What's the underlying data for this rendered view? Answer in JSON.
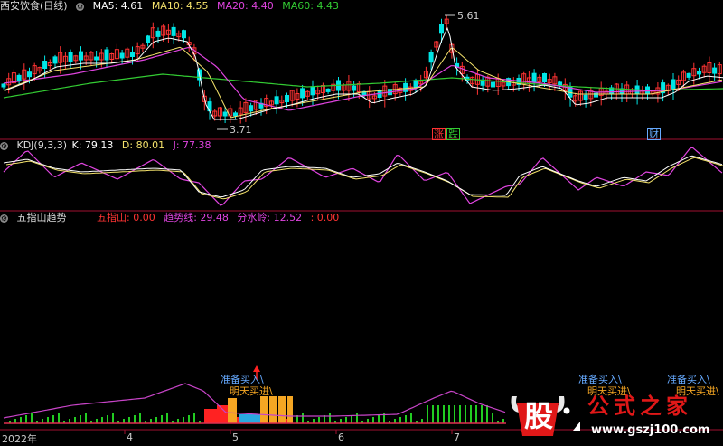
{
  "title": "西安饮食(日线)",
  "main_legend": [
    {
      "label": "MA5: 4.61",
      "color": "#ffffff"
    },
    {
      "label": "MA10: 4.55",
      "color": "#f4e26b"
    },
    {
      "label": "MA20: 4.40",
      "color": "#e044e0"
    },
    {
      "label": "MA60: 4.43",
      "color": "#33cc33"
    }
  ],
  "price_labels": {
    "high": "5.61",
    "low": "3.71"
  },
  "event_tags": [
    {
      "text": "涨",
      "color": "#ff3333"
    },
    {
      "text": "跌",
      "color": "#33cc33"
    },
    {
      "text": "财",
      "color": "#66aaff"
    }
  ],
  "kdj_header": {
    "name": "KDJ(9,3,3)",
    "k": "K: 79.13",
    "d": "D: 80.01",
    "j": "J: 77.38"
  },
  "five_header": {
    "name": "五指山趋势",
    "a": "五指山: 0.00",
    "b": "趋势线: 29.48",
    "c": "分水岭: 12.52",
    "d": ": 0.00"
  },
  "signals": {
    "ready_buy": "准备买入\\",
    "tomorrow_buy": "明天买进\\",
    "ready_buy_2": "准备买入\\",
    "ready_buy_3": "准备买入\\",
    "tomorrow_buy_2": "明天买进\\",
    "tomorrow_buy_3": "明天买进\\"
  },
  "x_axis": [
    "2022年",
    "4",
    "5",
    "6",
    "7"
  ],
  "watermark": {
    "char": "股",
    "brand": "公式之家",
    "url": "www.gszj100.com"
  },
  "colors": {
    "up": "#ff3333",
    "down": "#00e5e5",
    "ma5": "#ffffff",
    "ma10": "#f4e26b",
    "ma20": "#e044e0",
    "ma60": "#33cc33",
    "k": "#ffffff",
    "d": "#f4e26b",
    "j": "#e044e0",
    "divider": "#a01030"
  }
}
